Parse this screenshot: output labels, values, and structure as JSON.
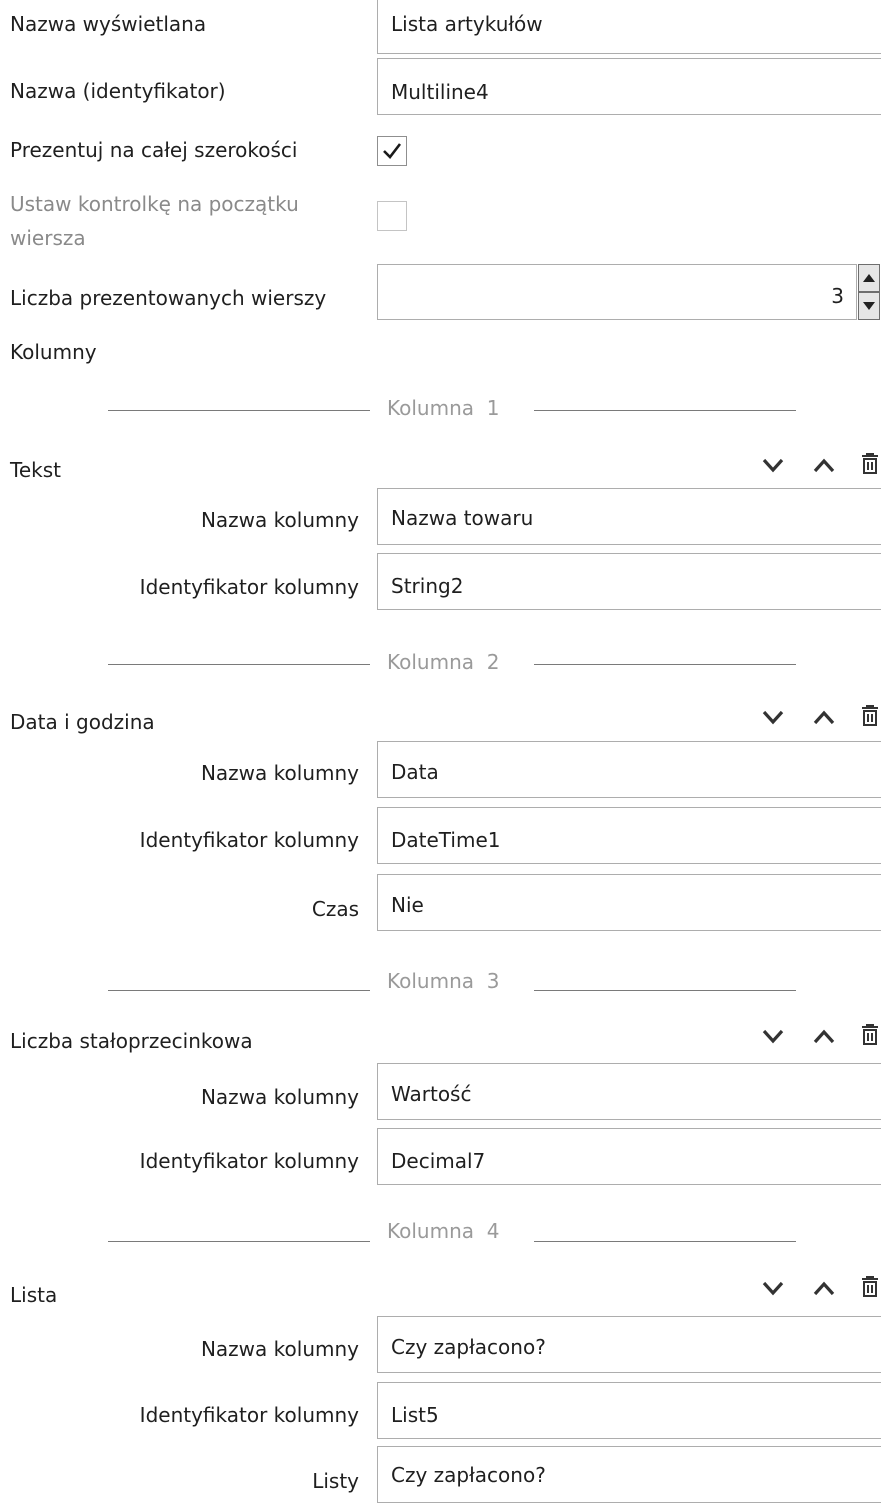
{
  "general": {
    "display_name": {
      "label": "Nazwa wyświetlana",
      "value": "Lista artykułów"
    },
    "identifier": {
      "label": "Nazwa (identyfikator)",
      "value": "Multiline4"
    },
    "full_width": {
      "label": "Prezentuj na całej szerokości",
      "checked": true
    },
    "row_start": {
      "label": "Ustaw kontrolkę na początku",
      "label2": "wiersza",
      "checked": false
    },
    "rows_count": {
      "label": "Liczba prezentowanych wierszy",
      "value": "3"
    },
    "columns_label": "Kolumny"
  },
  "columns": [
    {
      "separator_word": "Kolumna",
      "separator_num": "1",
      "type": "Tekst",
      "name_label": "Nazwa kolumny",
      "name_value": "Nazwa towaru",
      "id_label": "Identyfikator kolumny",
      "id_value": "String2"
    },
    {
      "separator_word": "Kolumna",
      "separator_num": "2",
      "type": "Data i godzina",
      "name_label": "Nazwa kolumny",
      "name_value": "Data",
      "id_label": "Identyfikator kolumny",
      "id_value": "DateTime1",
      "extra_label": "Czas",
      "extra_value": "Nie"
    },
    {
      "separator_word": "Kolumna",
      "separator_num": "3",
      "type": "Liczba stałoprzecinkowa",
      "name_label": "Nazwa kolumny",
      "name_value": "Wartość",
      "id_label": "Identyfikator kolumny",
      "id_value": "Decimal7"
    },
    {
      "separator_word": "Kolumna",
      "separator_num": "4",
      "type": "Lista",
      "name_label": "Nazwa kolumny",
      "name_value": "Czy zapłacono?",
      "id_label": "Identyfikator kolumny",
      "id_value": "List5",
      "extra_label": "Listy",
      "extra_value": "Czy zapłacono?"
    }
  ],
  "icons": {
    "move_down": "chevron-down-icon",
    "move_up": "chevron-up-icon",
    "delete": "trash-icon",
    "dropdown": "chevron-down-icon",
    "check": "check-icon"
  },
  "colors": {
    "border": "#adadad",
    "text": "#1f1f1f",
    "disabled_text": "#8a8a8a",
    "separator_text": "#9a9a9a"
  }
}
